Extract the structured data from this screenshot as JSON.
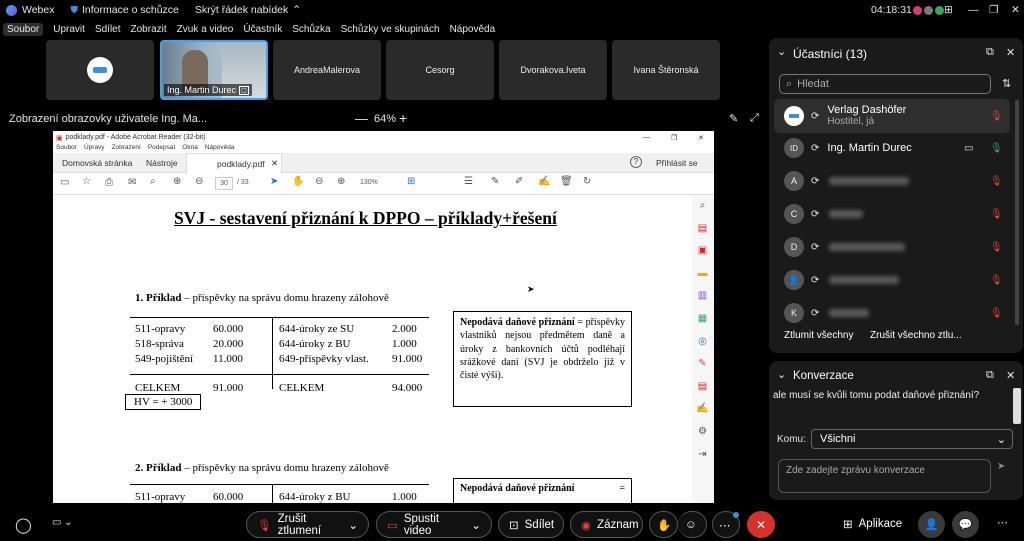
{
  "top": {
    "app_name": "Webex",
    "meeting_info": "Informace o schůzce",
    "hide_menu": "Skrýt řádek nabídek",
    "clock": "04:18:31"
  },
  "menu": [
    "Soubor",
    "Upravit",
    "Sdílet",
    "Zobrazit",
    "Zvuk a video",
    "Účastník",
    "Schůzka",
    "Schůzky ve skupinách",
    "Nápověda"
  ],
  "tiles": {
    "t1": "",
    "t2_name": "Ing. Martin Durec",
    "t3": "AndreaMalerova",
    "t4": "Cesorg",
    "t5": "Dvorakova.Iveta",
    "t6": "Ivana Štěronská"
  },
  "share": {
    "label": "Zobrazení obrazovky uživatele Ing. Ma...",
    "zoom": "64%"
  },
  "pdf": {
    "title": "podklady.pdf - Adobe Acrobat Reader (32-bit)",
    "menu": [
      "Soubor",
      "Úpravy",
      "Zobrazení",
      "Podepsat",
      "Okna",
      "Nápověda"
    ],
    "tab_home": "Domovská stránka",
    "tab_tools": "Nástroje",
    "tab_file": "podklady.pdf",
    "signin": "Přihlásit se",
    "page_current": "30",
    "page_total": "/ 33",
    "zoom": "130%"
  },
  "doc": {
    "title": "SVJ - sestavení přiznání k DPPO – příklady+řešení",
    "ex1_head": "1. Příklad",
    "ex1_sub": "– příspěvky na správu domu hrazeny zálohově",
    "left_rows": [
      [
        "511-opravy",
        "60.000"
      ],
      [
        "518-správa",
        "20.000"
      ],
      [
        "549-pojištění",
        "11.000"
      ]
    ],
    "right_rows": [
      [
        "644-úroky ze SU",
        "2.000"
      ],
      [
        "644-úroky z BU",
        "1.000"
      ],
      [
        "649-příspěvky vlast.",
        "91.000"
      ]
    ],
    "celkem": "CELKEM",
    "left_total": "91.000",
    "right_total": "94.000",
    "hv": "HV = + 3000",
    "note_bold": "Nepodává daňové přiznání",
    "note_rest": "= příspěvky vlastníků nejsou předmětem daně a úroky z bankovních účtů podléhají srážkové dani (SVJ je obdrželo již v čisté výši).",
    "ex2_head": "2. Příklad",
    "ex2_sub": "– příspěvky na správu domu hrazeny zálohově",
    "ex2_row_l": [
      "511-opravy",
      "60.000"
    ],
    "ex2_row_r": [
      "644-úroky z BU",
      "1.000"
    ],
    "note2_bold": "Nepodává daňové přiznání",
    "note2_eq": "="
  },
  "participants": {
    "title": "Účastníci (13)",
    "search_placeholder": "Hledat",
    "host_name": "Verlag Dashöfer",
    "host_role": "Hostitel, já",
    "p2": "Ing. Martin Durec",
    "p2_initials": "ID",
    "avatars": [
      "A",
      "C",
      "D",
      "",
      "K"
    ],
    "mute_all": "Ztlumit všechny",
    "unmute_all": "Zrušit všechno ztlu..."
  },
  "chat": {
    "title": "Konverzace",
    "message": "ale musí se kvůli tomu podat daňové přiznání?",
    "to_label": "Komu:",
    "to_value": "Všichni",
    "placeholder": "Zde zadejte zprávu konverzace"
  },
  "controls": {
    "unmute": "Zrušit ztlumení",
    "video": "Spustit video",
    "share": "Sdílet",
    "record": "Záznam",
    "apps": "Aplikace"
  }
}
